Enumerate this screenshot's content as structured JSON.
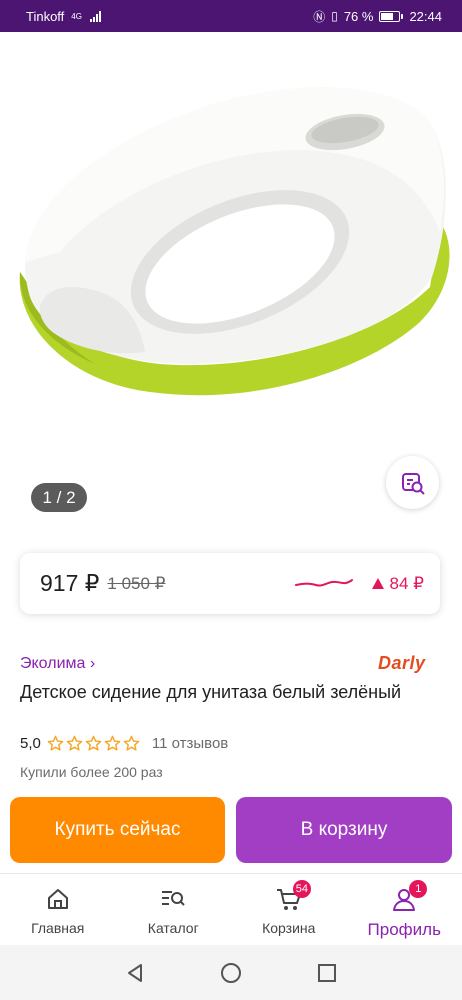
{
  "status_bar": {
    "carrier": "Tinkoff",
    "network": "4G",
    "battery": "76 %",
    "battery_level": 0.76,
    "time": "22:44"
  },
  "gallery": {
    "counter": "1 / 2"
  },
  "price": {
    "current": "917 ₽",
    "old": "1 050 ₽",
    "change": "84 ₽"
  },
  "product": {
    "seller": "Эколима ›",
    "brand": "Darly",
    "title": "Детское сидение для унитаза белый зелёный",
    "rating": "5,0",
    "stars": 5,
    "reviews": "11 отзывов",
    "bought": "Купили более 200 раз"
  },
  "actions": {
    "buy_now": "Купить сейчас",
    "add_to_cart": "В корзину"
  },
  "bottom_nav": {
    "home": "Главная",
    "catalog": "Каталог",
    "cart": "Корзина",
    "cart_badge": "54",
    "profile": "Профиль",
    "profile_badge": "1"
  },
  "colors": {
    "status_bar": "#4b1571",
    "accent_purple": "#a23ec3",
    "accent_orange": "#ff8a00",
    "price_up": "#e4165a",
    "star": "#f5a623"
  }
}
